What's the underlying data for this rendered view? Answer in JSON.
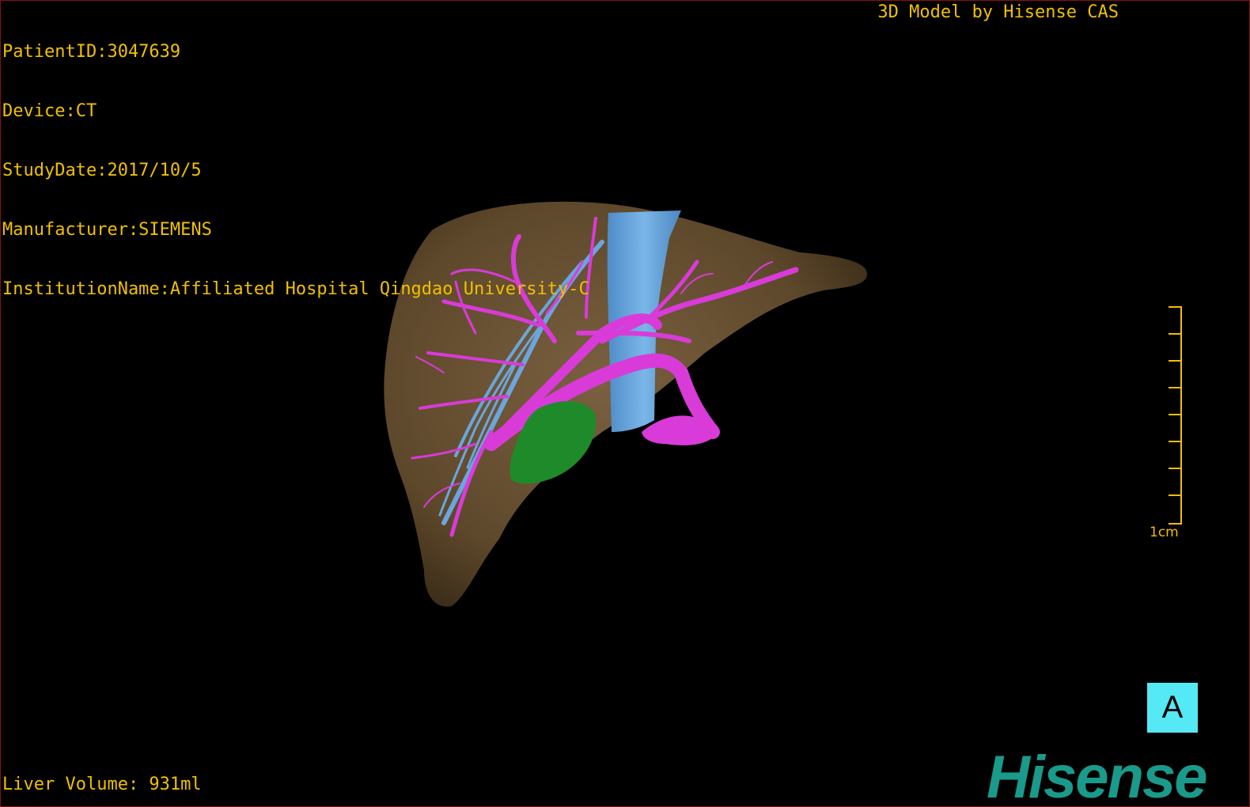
{
  "overlay": {
    "patient_id": "PatientID:3047639",
    "device": "Device:CT",
    "study_date": "StudyDate:2017/10/5",
    "manufacturer": "Manufacturer:SIEMENS",
    "institution": "InstitutionName:Affiliated Hospital Qingdao University-C",
    "brand": "3D Model by Hisense CAS",
    "liver_volume": "Liver Volume: 931ml"
  },
  "scale": {
    "label": "1cm"
  },
  "orientation": {
    "label": "A"
  },
  "logo": {
    "text": "Hisense"
  },
  "colors": {
    "overlay_text": "#f0c000",
    "liver": "#6b5232",
    "hepatic_vein": "#d93bd9",
    "portal_vein": "#6aa6dc",
    "lesion": "#1f8a2a",
    "orientation_box": "#55e8f5",
    "logo": "#1a9a8a"
  }
}
